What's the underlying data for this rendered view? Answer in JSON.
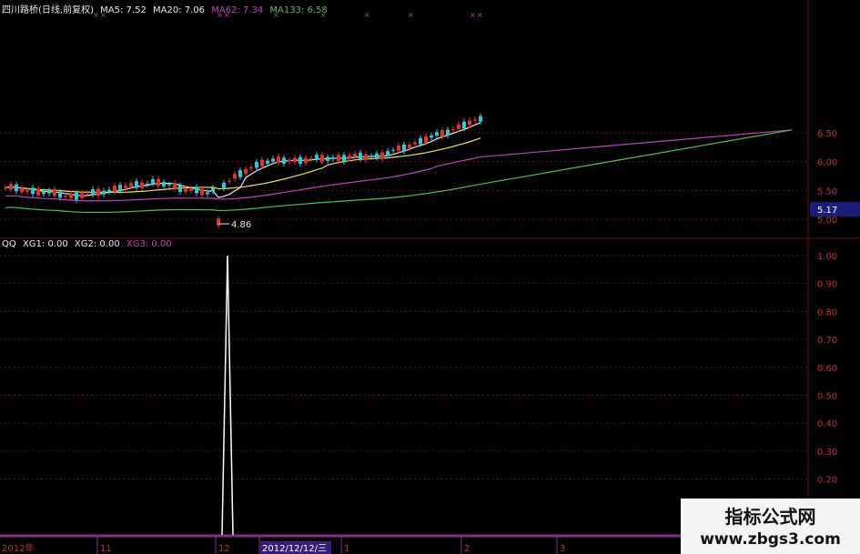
{
  "header": {
    "stock": "四川路桥(日线,前复权)",
    "ma5": "MA5: 7.52",
    "ma20": "MA20: 7.06",
    "ma62": "MA62: 7.34",
    "ma133": "MA133: 6.58"
  },
  "sub_header": {
    "name": "QQ",
    "xg1": "XG1: 0.00",
    "xg2": "XG2: 0.00",
    "xg3": "XG3: 0.00"
  },
  "colors": {
    "up": "#e03030",
    "down": "#30c8d8",
    "ma5": "#e8e8e8",
    "ma20": "#f0e060",
    "ma62": "#c040c0",
    "ma133": "#50c050",
    "grid": "#6a0c0c",
    "axis_text": "#c03030",
    "signal": "#ffffff",
    "marker": "#c040c0"
  },
  "chart_data": [
    {
      "type": "candlestick",
      "y_ticks": [
        "6.50",
        "6.00",
        "5.50",
        "5.00"
      ],
      "current_price": "5.17",
      "low_annotation": "4.86",
      "series": [
        {
          "name": "MA5"
        },
        {
          "name": "MA20"
        },
        {
          "name": "MA62"
        },
        {
          "name": "MA133"
        }
      ]
    },
    {
      "type": "line",
      "y_ticks": [
        "1.00",
        "0.90",
        "0.80",
        "0.70",
        "0.60",
        "0.50",
        "0.40",
        "0.30",
        "0.20"
      ],
      "signal_value": 1.0,
      "signal_date": "2012/12/12/三"
    }
  ],
  "x_axis": {
    "labels": [
      "2012年",
      "11",
      "12",
      "2012/12/12/三",
      "1",
      "2",
      "3"
    ]
  },
  "watermark": {
    "title": "指标公式网",
    "url": "www.zbgs3.com"
  }
}
